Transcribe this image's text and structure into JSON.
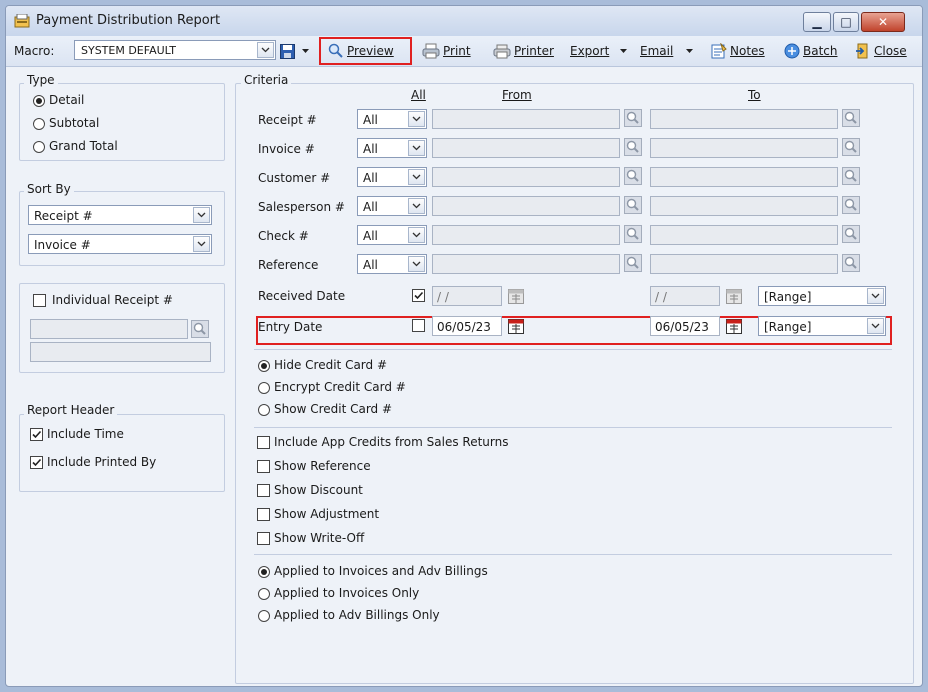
{
  "window": {
    "title": "Payment Distribution Report"
  },
  "toolbar": {
    "macro_label": "Macro:",
    "macro_value": "SYSTEM DEFAULT",
    "preview": "Preview",
    "print": "Print",
    "printer": "Printer",
    "export": "Export",
    "email": "Email",
    "notes": "Notes",
    "batch": "Batch",
    "close": "Close"
  },
  "type_panel": {
    "legend": "Type",
    "options": [
      "Detail",
      "Subtotal",
      "Grand Total"
    ],
    "selected": "Detail"
  },
  "sort_panel": {
    "legend": "Sort By",
    "sort1": "Receipt #",
    "sort2": "Invoice #"
  },
  "individual": {
    "label": "Individual Receipt #",
    "checked": false
  },
  "report_header": {
    "legend": "Report Header",
    "include_time": "Include Time",
    "include_printed_by": "Include Printed By"
  },
  "criteria": {
    "legend": "Criteria",
    "col_all": "All",
    "col_from": "From",
    "col_to": "To",
    "rows": [
      {
        "label": "Receipt #",
        "mode": "All"
      },
      {
        "label": "Invoice #",
        "mode": "All"
      },
      {
        "label": "Customer #",
        "mode": "All"
      },
      {
        "label": "Salesperson #",
        "mode": "All"
      },
      {
        "label": "Check #",
        "mode": "All"
      },
      {
        "label": "Reference",
        "mode": "All"
      }
    ],
    "received_date": {
      "label": "Received Date",
      "from": "/ /",
      "to": "/ /",
      "range": "[Range]",
      "all_checked": true
    },
    "entry_date": {
      "label": "Entry Date",
      "from": "06/05/23",
      "to": "06/05/23",
      "range": "[Range]",
      "all_checked": false
    }
  },
  "credit_card": {
    "options": [
      "Hide Credit Card #",
      "Encrypt Credit Card #",
      "Show Credit Card #"
    ],
    "selected": "Hide Credit Card #"
  },
  "options": {
    "items": [
      "Include App Credits from Sales Returns",
      "Show Reference",
      "Show Discount",
      "Show Adjustment",
      "Show Write-Off"
    ]
  },
  "applied": {
    "options": [
      "Applied to Invoices and Adv Billings",
      "Applied to Invoices Only",
      "Applied to Adv Billings Only"
    ],
    "selected": "Applied to Invoices and Adv Billings"
  },
  "colors": {
    "highlight": "#e02020",
    "window_bg": "#eef2f8",
    "accent": "#2f6fd0"
  }
}
